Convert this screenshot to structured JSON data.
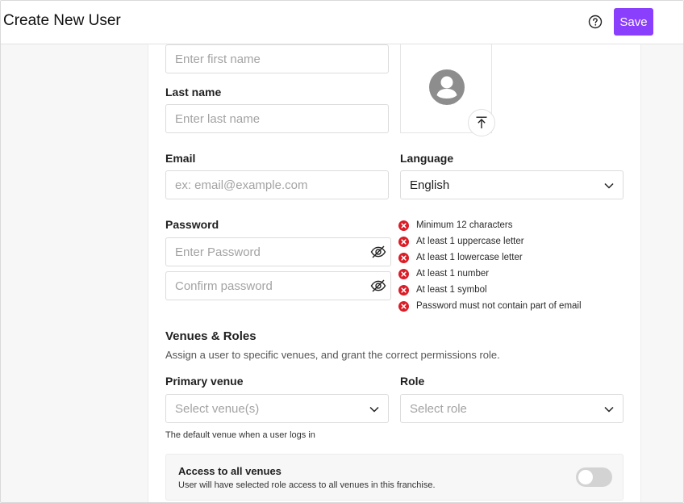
{
  "header": {
    "title": "Create New User",
    "save_label": "Save"
  },
  "form": {
    "first_name": {
      "placeholder": "Enter first name",
      "value": ""
    },
    "last_name": {
      "label": "Last name",
      "placeholder": "Enter last name",
      "value": ""
    },
    "email": {
      "label": "Email",
      "placeholder": "ex: email@example.com",
      "value": ""
    },
    "language": {
      "label": "Language",
      "selected": "English"
    },
    "password": {
      "label": "Password",
      "placeholder": "Enter Password",
      "confirm_placeholder": "Confirm password"
    },
    "password_rules": [
      "Minimum 12 characters",
      "At least 1 uppercase letter",
      "At least 1 lowercase letter",
      "At least 1 number",
      "At least 1 symbol",
      "Password must not contain part of email"
    ]
  },
  "venues": {
    "title": "Venues & Roles",
    "description": "Assign a user to specific venues, and grant the correct permissions role.",
    "primary_venue": {
      "label": "Primary venue",
      "placeholder": "Select venue(s)",
      "hint": "The default venue when a user logs in"
    },
    "role": {
      "label": "Role",
      "placeholder": "Select role"
    },
    "access_all": {
      "title": "Access to all venues",
      "description": "User will have selected role access to all venues in this franchise.",
      "enabled": false
    }
  },
  "colors": {
    "accent": "#8a3ffc",
    "error": "#da1e28",
    "avatar": "#8d8d8d"
  },
  "icons": {
    "help": "question-circle-icon",
    "avatar": "user-avatar-icon",
    "upload": "upload-icon",
    "eye": "eye-off-icon",
    "chevron": "chevron-down-icon",
    "rule_fail": "error-x-icon"
  }
}
